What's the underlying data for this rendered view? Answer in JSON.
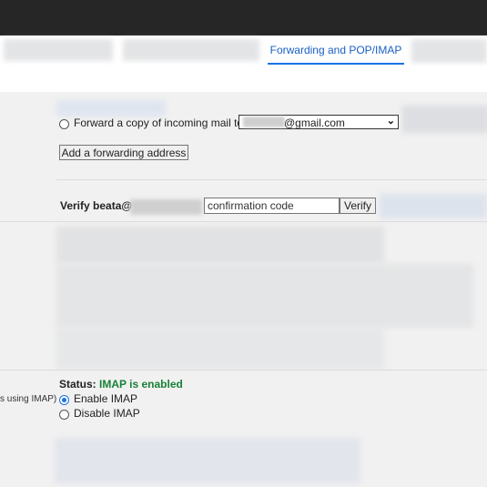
{
  "tabs": {
    "active_label": "Forwarding and POP/IMAP"
  },
  "forwarding": {
    "forward_label": "Forward a copy of incoming mail to",
    "forward_address_visible": "@gmail.com",
    "add_button": "Add a forwarding address",
    "verify_label": "Verify beata@",
    "code_placeholder": "confirmation code",
    "verify_button": "Verify"
  },
  "imap": {
    "side_label": "s using IMAP)",
    "status_label": "Status:",
    "status_value": "IMAP is enabled",
    "enable_label": "Enable IMAP",
    "disable_label": "Disable IMAP"
  },
  "colors": {
    "status_green": "#188038",
    "accent": "#1a73e8",
    "topbar": "#262626"
  }
}
